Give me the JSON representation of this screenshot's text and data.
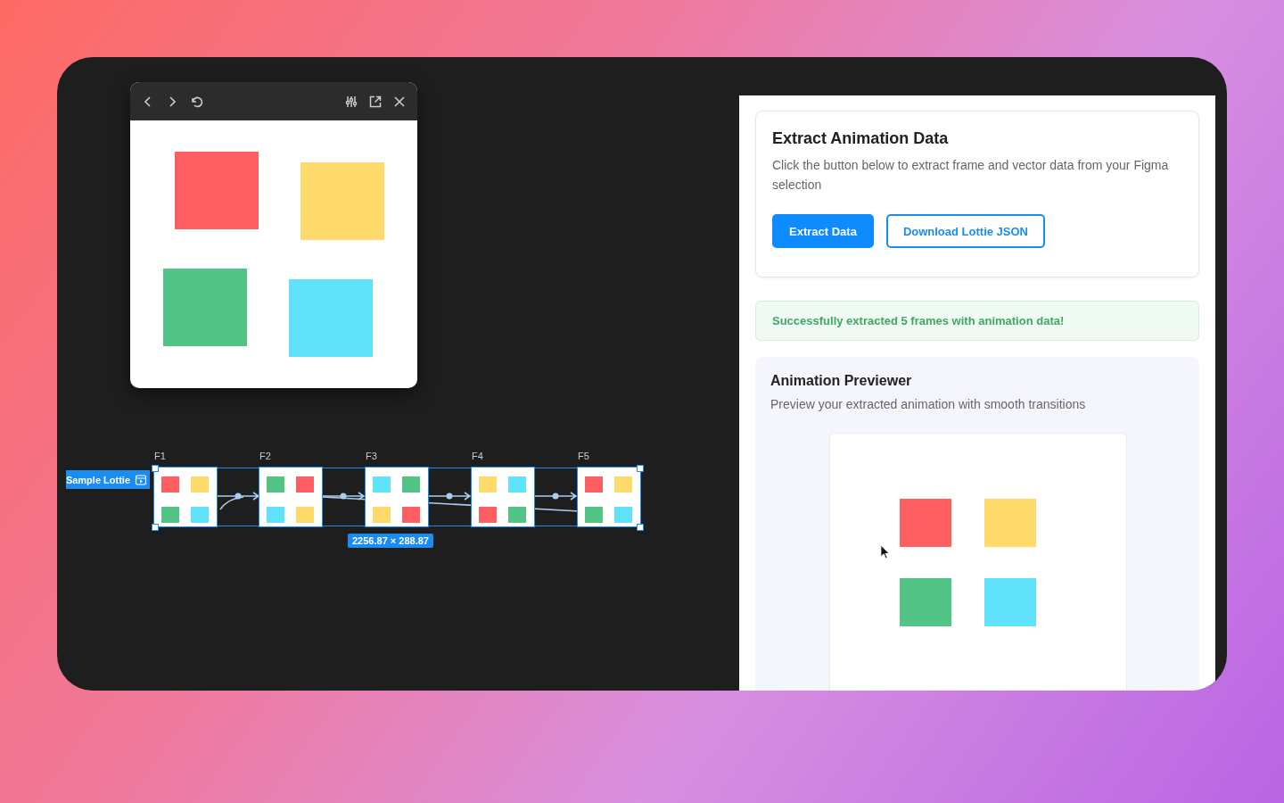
{
  "preview_window": {
    "squares": [
      {
        "color": "#fe5f63"
      },
      {
        "color": "#fed96b"
      },
      {
        "color": "#52c486"
      },
      {
        "color": "#61e2fb"
      }
    ]
  },
  "frames": [
    {
      "label": "F1",
      "squares": [
        {
          "color": "#fe5f63"
        },
        {
          "color": "#fed96b"
        },
        {
          "color": "#52c486"
        },
        {
          "color": "#61e2fb"
        }
      ]
    },
    {
      "label": "F2",
      "squares": [
        {
          "color": "#52c486"
        },
        {
          "color": "#fe5f63"
        },
        {
          "color": "#61e2fb"
        },
        {
          "color": "#fed96b"
        }
      ]
    },
    {
      "label": "F3",
      "squares": [
        {
          "color": "#61e2fb"
        },
        {
          "color": "#52c486"
        },
        {
          "color": "#fed96b"
        },
        {
          "color": "#fe5f63"
        }
      ]
    },
    {
      "label": "F4",
      "squares": [
        {
          "color": "#fed96b"
        },
        {
          "color": "#61e2fb"
        },
        {
          "color": "#fe5f63"
        },
        {
          "color": "#52c486"
        }
      ]
    },
    {
      "label": "F5",
      "squares": [
        {
          "color": "#fe5f63"
        },
        {
          "color": "#fed96b"
        },
        {
          "color": "#52c486"
        },
        {
          "color": "#61e2fb"
        }
      ]
    }
  ],
  "selection": {
    "layer_tag": "Sample Lottie",
    "dimensions": "2256.87 × 288.87"
  },
  "extract_card": {
    "title": "Extract Animation Data",
    "description": "Click the button below to extract frame and vector data from your Figma selection",
    "buttons": [
      {
        "label": "Extract Data",
        "kind": "primary"
      },
      {
        "label": "Download Lottie JSON",
        "kind": "outline"
      }
    ]
  },
  "status_message": "Successfully extracted 5 frames with animation data!",
  "previewer": {
    "title": "Animation Previewer",
    "description": "Preview your extracted animation with smooth transitions",
    "squares": [
      {
        "color": "#fe5f63"
      },
      {
        "color": "#fed96b"
      },
      {
        "color": "#52c486"
      },
      {
        "color": "#61e2fb"
      }
    ]
  }
}
